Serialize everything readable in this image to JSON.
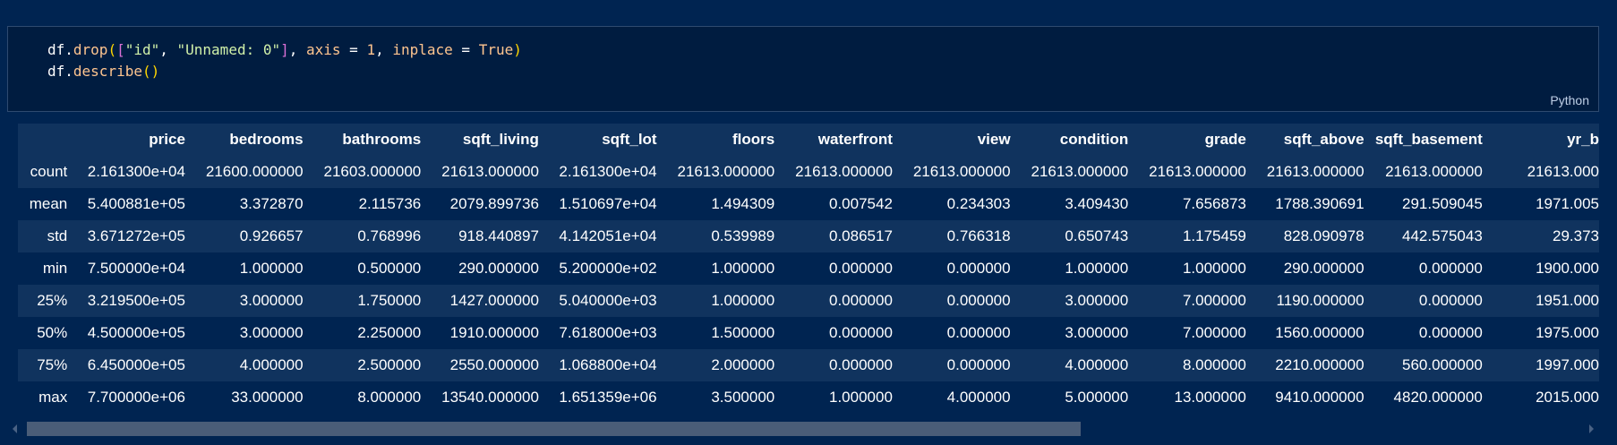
{
  "code_cell": {
    "lines": [
      [
        {
          "t": "df",
          "c": "t-default"
        },
        {
          "t": ".",
          "c": "t-op"
        },
        {
          "t": "drop",
          "c": "t-func"
        },
        {
          "t": "(",
          "c": "t-bracket-1"
        },
        {
          "t": "[",
          "c": "t-bracket-2"
        },
        {
          "t": "\"id\"",
          "c": "t-string"
        },
        {
          "t": ", ",
          "c": "t-op"
        },
        {
          "t": "\"Unnamed: 0\"",
          "c": "t-string"
        },
        {
          "t": "]",
          "c": "t-bracket-2"
        },
        {
          "t": ", ",
          "c": "t-op"
        },
        {
          "t": "axis",
          "c": "t-kw"
        },
        {
          "t": " = ",
          "c": "t-op"
        },
        {
          "t": "1",
          "c": "t-number"
        },
        {
          "t": ", ",
          "c": "t-op"
        },
        {
          "t": "inplace",
          "c": "t-kw"
        },
        {
          "t": " = ",
          "c": "t-op"
        },
        {
          "t": "True",
          "c": "t-number"
        },
        {
          "t": ")",
          "c": "t-bracket-1"
        }
      ],
      [
        {
          "t": "df",
          "c": "t-default"
        },
        {
          "t": ".",
          "c": "t-op"
        },
        {
          "t": "describe",
          "c": "t-func"
        },
        {
          "t": "()",
          "c": "t-bracket-1"
        }
      ]
    ],
    "language": "Python"
  },
  "table": {
    "columns": [
      "price",
      "bedrooms",
      "bathrooms",
      "sqft_living",
      "sqft_lot",
      "floors",
      "waterfront",
      "view",
      "condition",
      "grade",
      "sqft_above",
      "sqft_basement",
      "yr_b"
    ],
    "rows": [
      {
        "index": "count",
        "values": [
          "2.161300e+04",
          "21600.000000",
          "21603.000000",
          "21613.000000",
          "2.161300e+04",
          "21613.000000",
          "21613.000000",
          "21613.000000",
          "21613.000000",
          "21613.000000",
          "21613.000000",
          "21613.000000",
          "21613.000"
        ]
      },
      {
        "index": "mean",
        "values": [
          "5.400881e+05",
          "3.372870",
          "2.115736",
          "2079.899736",
          "1.510697e+04",
          "1.494309",
          "0.007542",
          "0.234303",
          "3.409430",
          "7.656873",
          "1788.390691",
          "291.509045",
          "1971.005"
        ]
      },
      {
        "index": "std",
        "values": [
          "3.671272e+05",
          "0.926657",
          "0.768996",
          "918.440897",
          "4.142051e+04",
          "0.539989",
          "0.086517",
          "0.766318",
          "0.650743",
          "1.175459",
          "828.090978",
          "442.575043",
          "29.373"
        ]
      },
      {
        "index": "min",
        "values": [
          "7.500000e+04",
          "1.000000",
          "0.500000",
          "290.000000",
          "5.200000e+02",
          "1.000000",
          "0.000000",
          "0.000000",
          "1.000000",
          "1.000000",
          "290.000000",
          "0.000000",
          "1900.000"
        ]
      },
      {
        "index": "25%",
        "values": [
          "3.219500e+05",
          "3.000000",
          "1.750000",
          "1427.000000",
          "5.040000e+03",
          "1.000000",
          "0.000000",
          "0.000000",
          "3.000000",
          "7.000000",
          "1190.000000",
          "0.000000",
          "1951.000"
        ]
      },
      {
        "index": "50%",
        "values": [
          "4.500000e+05",
          "3.000000",
          "2.250000",
          "1910.000000",
          "7.618000e+03",
          "1.500000",
          "0.000000",
          "0.000000",
          "3.000000",
          "7.000000",
          "1560.000000",
          "0.000000",
          "1975.000"
        ]
      },
      {
        "index": "75%",
        "values": [
          "6.450000e+05",
          "4.000000",
          "2.500000",
          "2550.000000",
          "1.068800e+04",
          "2.000000",
          "0.000000",
          "0.000000",
          "4.000000",
          "8.000000",
          "2210.000000",
          "560.000000",
          "1997.000"
        ]
      },
      {
        "index": "max",
        "values": [
          "7.700000e+06",
          "33.000000",
          "8.000000",
          "13540.000000",
          "1.651359e+06",
          "3.500000",
          "1.000000",
          "4.000000",
          "5.000000",
          "13.000000",
          "9410.000000",
          "4820.000000",
          "2015.000"
        ]
      }
    ]
  },
  "colors": {
    "background": "#002451",
    "code_background": "#001c40",
    "table_stripe": "#10335e",
    "scroll_thumb": "#4a5d78"
  }
}
